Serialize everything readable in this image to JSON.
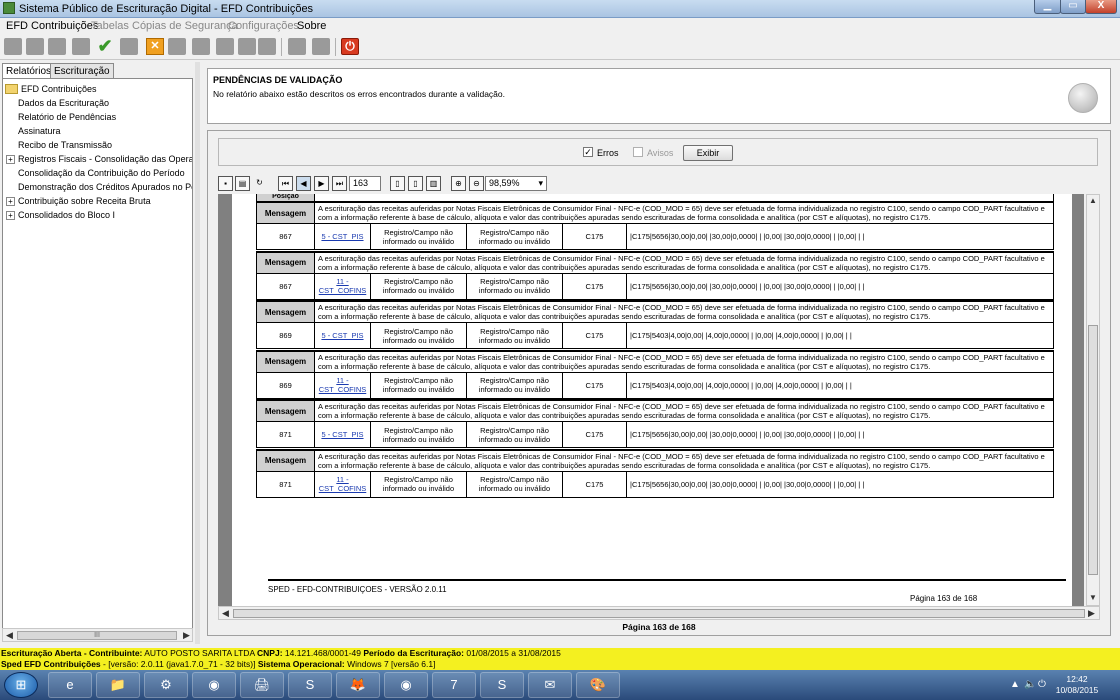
{
  "window": {
    "title": "Sistema Público de Escrituração Digital - EFD Contribuições",
    "min": "▁",
    "max": "▭",
    "close": "X"
  },
  "menu": [
    {
      "label": "EFD Contribuições",
      "enabled": true
    },
    {
      "label": "Tabelas",
      "enabled": false
    },
    {
      "label": "Cópias de Segurança",
      "enabled": false
    },
    {
      "label": "Configurações",
      "enabled": false
    },
    {
      "label": "Sobre",
      "enabled": true
    }
  ],
  "left_tabs": [
    "Relatórios",
    "Escrituração"
  ],
  "tree": {
    "root": "EFD Contribuições",
    "items": [
      {
        "label": "Dados da Escrituração",
        "expandable": false
      },
      {
        "label": "Relatório de Pendências",
        "expandable": false
      },
      {
        "label": "Assinatura",
        "expandable": false
      },
      {
        "label": "Recibo de Transmissão",
        "expandable": false
      },
      {
        "label": "Registros Fiscais - Consolidação das Operaçõ",
        "expandable": true
      },
      {
        "label": "Consolidação da Contribuição do Período",
        "expandable": false
      },
      {
        "label": "Demonstração dos Créditos Apurados no Perío",
        "expandable": false
      },
      {
        "label": "Contribuição sobre Receita Bruta",
        "expandable": true
      },
      {
        "label": "Consolidados do Bloco I",
        "expandable": true
      }
    ],
    "scroll_label": "III"
  },
  "header": {
    "title": "PENDÊNCIAS DE VALIDAÇÃO",
    "subtitle": "No relatório abaixo estão descritos os erros encontrados durante a validação."
  },
  "filter": {
    "errors_label": "Erros",
    "errors_checked": true,
    "warnings_label": "Avisos",
    "warnings_checked": false,
    "show_button": "Exibir"
  },
  "viewer": {
    "page_number": "163",
    "zoom": "98,59%"
  },
  "report": {
    "header_stub": "Posição",
    "message_label": "Mensagem",
    "message_text": "A escrituração das receitas auferidas por Notas Fiscais Eletrônicas de Consumidor Final - NFC-e (COD_MOD = 65) deve ser efetuada de forma individualizada no registro C100, sendo o campo COD_PART facultativo e com a informação referente à base de cálculo, alíquota e valor das contribuições apuradas sendo escrituradas de forma consolidada e analítica (por CST e alíquotas), no registro C175.",
    "rows": [
      {
        "line": "867",
        "field": "5 - CST_PIS",
        "desc1": "Registro/Campo não informado ou inválido",
        "desc2": "Registro/Campo não informado ou inválido",
        "register": "C175",
        "content": "|C175|5656|30,00|0,00| |30,00|0,0000| | |0,00| |30,00|0,0000| | |0,00| | |"
      },
      {
        "line": "867",
        "field": "11 - CST_COFINS",
        "desc1": "Registro/Campo não informado ou inválido",
        "desc2": "Registro/Campo não informado ou inválido",
        "register": "C175",
        "content": "|C175|5656|30,00|0,00| |30,00|0,0000| | |0,00| |30,00|0,0000| | |0,00| | |"
      },
      {
        "line": "869",
        "field": "5 - CST_PIS",
        "desc1": "Registro/Campo não informado ou inválido",
        "desc2": "Registro/Campo não informado ou inválido",
        "register": "C175",
        "content": "|C175|5403|4,00|0,00| |4,00|0,0000| | |0,00| |4,00|0,0000| | |0,00| | |"
      },
      {
        "line": "869",
        "field": "11 - CST_COFINS",
        "desc1": "Registro/Campo não informado ou inválido",
        "desc2": "Registro/Campo não informado ou inválido",
        "register": "C175",
        "content": "|C175|5403|4,00|0,00| |4,00|0,0000| | |0,00| |4,00|0,0000| | |0,00| | |"
      },
      {
        "line": "871",
        "field": "5 - CST_PIS",
        "desc1": "Registro/Campo não informado ou inválido",
        "desc2": "Registro/Campo não informado ou inválido",
        "register": "C175",
        "content": "|C175|5656|30,00|0,00| |30,00|0,0000| | |0,00| |30,00|0,0000| | |0,00| | |"
      },
      {
        "line": "871",
        "field": "11 - CST_COFINS",
        "desc1": "Registro/Campo não informado ou inválido",
        "desc2": "Registro/Campo não informado ou inválido",
        "register": "C175",
        "content": "|C175|5656|30,00|0,00| |30,00|0,0000| | |0,00| |30,00|0,0000| | |0,00| | |"
      }
    ],
    "footer_left": "SPED - EFD-CONTRIBUIÇOES - VERSÃO 2.0.11",
    "footer_right": "Página 163 de 168"
  },
  "page_indicator": "Página 163 de 168",
  "status": {
    "line1_a": "Escrituração Aberta - Contribuinte:",
    "line1_b": " AUTO POSTO SARITA LTDA ",
    "line1_c": "CNPJ:",
    "line1_d": " 14.121.468/0001-49 ",
    "line1_e": "Período da Escrituração:",
    "line1_f": " 01/08/2015 a 31/08/2015",
    "line2_a": "Sped EFD Contribuições",
    "line2_b": " - [versão: 2.0.11 (java1.7.0_71 - 32 bits)] ",
    "line2_c": "Sistema Operacional:",
    "line2_d": " Windows 7 [versão 6.1]"
  },
  "taskbar": {
    "apps": [
      "e",
      "📁",
      "⚙",
      "◉",
      "🖨",
      "S",
      "🦊",
      "◉",
      "7",
      "S",
      "✉",
      "🎨"
    ],
    "time": "12:42",
    "date": "10/08/2015",
    "tray_icons": [
      "▲",
      "🔈",
      "⏻"
    ]
  }
}
